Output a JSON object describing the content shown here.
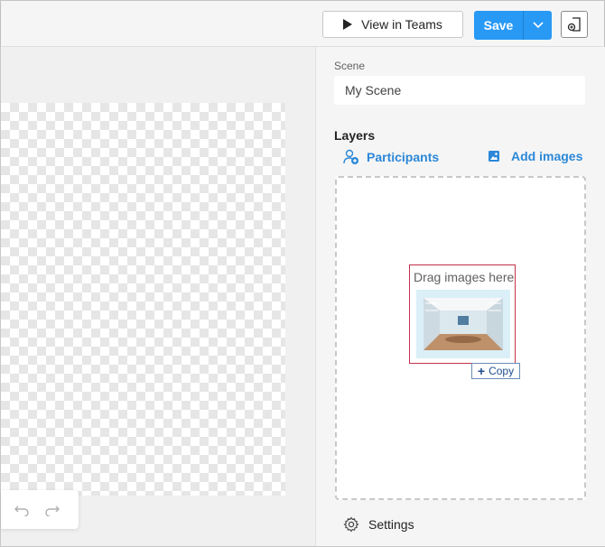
{
  "toolbar": {
    "view_in_teams_label": "View in Teams",
    "save_label": "Save",
    "icons": {
      "play": "play-icon",
      "chevron": "chevron-down-icon",
      "export": "export-icon"
    }
  },
  "colors": {
    "accent": "#2899f5",
    "link": "#2b88d8",
    "drag_border": "#c4314b"
  },
  "scene": {
    "label": "Scene",
    "value": "My Scene"
  },
  "layers": {
    "title": "Layers",
    "participants_label": "Participants",
    "add_images_label": "Add images",
    "drop_text": "Drag images here",
    "copy_label": "Copy"
  },
  "settings": {
    "label": "Settings"
  }
}
